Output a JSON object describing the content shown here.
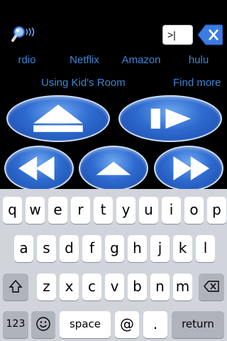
{
  "search": {
    "icon": "magnifier-signal-icon"
  },
  "input": {
    "value": ">|"
  },
  "clear": {
    "icon": "clear-x-icon"
  },
  "services": [
    {
      "label": "rdio"
    },
    {
      "label": "Netflix"
    },
    {
      "label": "Amazon"
    },
    {
      "label": "hulu"
    }
  ],
  "links": {
    "kids_room": "Using Kid's Room",
    "find_more": "Find more"
  },
  "remote": {
    "buttons": [
      "eject-icon",
      "play-icon",
      "rewind-icon",
      "up-icon",
      "fast-forward-icon"
    ]
  },
  "keyboard": {
    "row1": [
      "q",
      "w",
      "e",
      "r",
      "t",
      "y",
      "u",
      "i",
      "o",
      "p"
    ],
    "row2": [
      "a",
      "s",
      "d",
      "f",
      "g",
      "h",
      "j",
      "k",
      "l"
    ],
    "row3": [
      "z",
      "x",
      "c",
      "v",
      "b",
      "n",
      "m"
    ],
    "numbers_key": "123",
    "space_key": "space",
    "at_key": "@",
    "dot_key": ".",
    "return_key": "return",
    "icons": {
      "shift": "shift-icon",
      "backspace": "backspace-icon",
      "emoji": "emoji-icon"
    }
  }
}
